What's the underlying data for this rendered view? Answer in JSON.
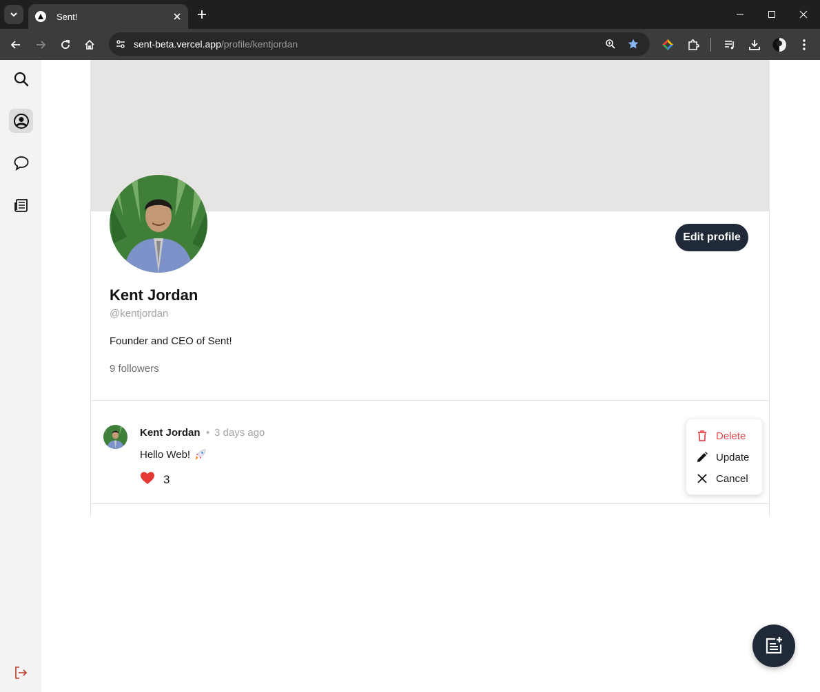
{
  "browser": {
    "tab_title": "Sent!",
    "url_host": "sent-beta.vercel.app",
    "url_path": "/profile/kentjordan"
  },
  "sidebar": {
    "items": [
      {
        "name": "search",
        "icon": "search-icon"
      },
      {
        "name": "profile",
        "icon": "user-circle-icon",
        "active": true
      },
      {
        "name": "messages",
        "icon": "chat-bubble-icon"
      },
      {
        "name": "feed",
        "icon": "newspaper-icon"
      }
    ],
    "logout_icon": "logout-icon"
  },
  "profile": {
    "name": "Kent Jordan",
    "handle": "@kentjordan",
    "bio": "Founder and CEO of Sent!",
    "followers": "9 followers",
    "edit_label": "Edit profile"
  },
  "post": {
    "author": "Kent Jordan",
    "separator": "•",
    "time": "3 days ago",
    "text": "Hello Web!",
    "emoji": "rocket",
    "likes": "3"
  },
  "menu": {
    "delete": "Delete",
    "update": "Update",
    "cancel": "Cancel"
  },
  "colors": {
    "accent_dark": "#1f2937",
    "danger": "#e5484d",
    "banner": "#e6e5e3"
  }
}
